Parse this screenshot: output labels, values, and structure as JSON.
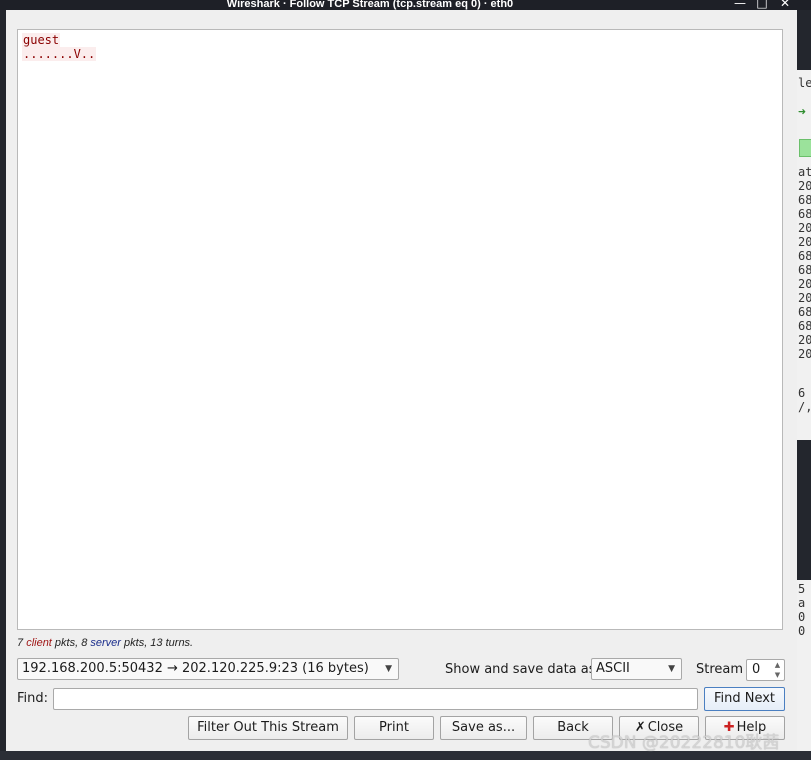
{
  "window": {
    "title": "Wireshark · Follow TCP Stream (tcp.stream eq 0) · eth0",
    "controls": {
      "minimize": "—",
      "maximize": "□",
      "close": "✕"
    }
  },
  "stream": {
    "chunks": [
      {
        "text": "guest",
        "side": "client"
      },
      {
        "text": ".......V..",
        "side": "client"
      }
    ]
  },
  "stats": {
    "client_count": "7",
    "client_word": "client",
    "pkts_mid": " pkts, 8 ",
    "server_word": "server",
    "tail": " pkts, 13 turns."
  },
  "conversation": {
    "selected": "192.168.200.5:50432 → 202.120.225.9:23 (16 bytes)"
  },
  "show_save": {
    "label": "Show and save data as",
    "selected": "ASCII"
  },
  "stream_number": {
    "label": "Stream",
    "value": "0"
  },
  "find": {
    "label": "Find:",
    "value": "",
    "find_next": "Find Next"
  },
  "buttons": {
    "filter_out": "Filter Out This Stream",
    "print": "Print",
    "save_as": "Save as...",
    "back": "Back",
    "close": "Close",
    "help": "Help"
  },
  "background_app": {
    "right_edge_text": [
      "le",
      "at",
      "20",
      "68",
      "68",
      "20",
      "20",
      "68",
      "68",
      "20",
      "20",
      "68",
      "68",
      "20",
      "20",
      "6",
      "/,",
      "5",
      "a",
      "0",
      "0"
    ]
  },
  "watermark": "CSDN @20222810耿茜"
}
